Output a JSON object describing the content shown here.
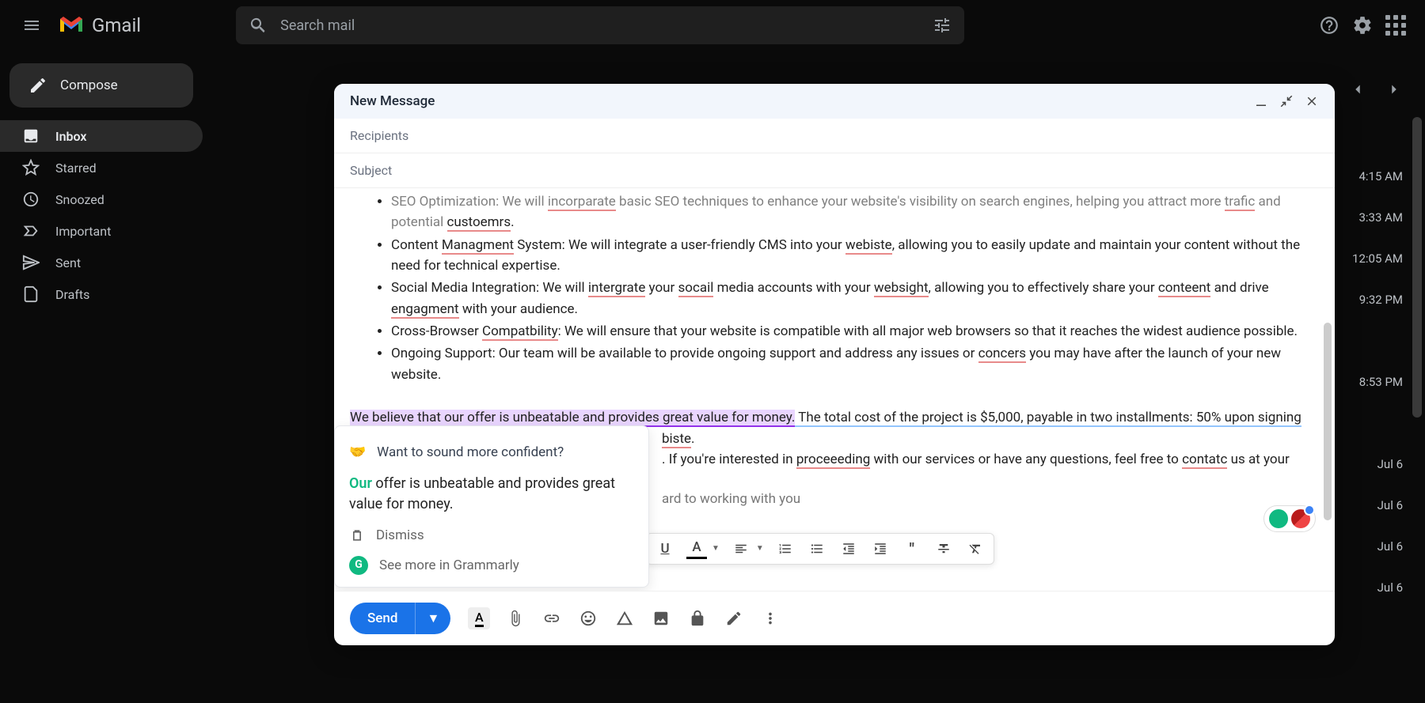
{
  "header": {
    "app_name": "Gmail",
    "search_placeholder": "Search mail"
  },
  "sidebar": {
    "compose": "Compose",
    "items": [
      {
        "label": "Inbox"
      },
      {
        "label": "Starred"
      },
      {
        "label": "Snoozed"
      },
      {
        "label": "Important"
      },
      {
        "label": "Sent"
      },
      {
        "label": "Drafts"
      }
    ]
  },
  "compose": {
    "title": "New Message",
    "recipients_label": "Recipients",
    "subject_label": "Subject",
    "send": "Send",
    "body": {
      "seo_pre": "SEO Optimization: We will ",
      "seo_m1": "incorparate",
      "seo_mid": " basic SEO techniques to enhance your website's visibility on search engines, helping you attract more ",
      "seo_m2": "trafic",
      "seo_post": " and potential ",
      "seo_m3": "custoemrs",
      "cms_pre": "Content ",
      "cms_m1": "Managment",
      "cms_mid": " System: We will integrate a user-friendly CMS into your ",
      "cms_m2": "webiste",
      "cms_post": ", allowing you to easily update and maintain your content without the need for technical expertise.",
      "social_pre": "Social Media Integration: We will ",
      "social_m1": "intergrate",
      "social_mid1": " your ",
      "social_m2": "socail",
      "social_mid2": " media accounts with your ",
      "social_m3": "websight",
      "social_mid3": ", allowing you to effectively share your ",
      "social_m4": "conteent",
      "social_mid4": " and drive ",
      "social_m5": "engagment",
      "social_post": " with your audience.",
      "cross_pre": "Cross-Browser ",
      "cross_m1": "Compatbility",
      "cross_post": ": We will ensure that your website is compatible with all major web browsers so that it reaches the widest audience possible.",
      "ongoing_pre": "Ongoing Support: Our team will be available to provide ongoing support and address any issues or ",
      "ongoing_m1": "concers",
      "ongoing_post": " you may have after the launch of your new website.",
      "believe": "We believe that our offer is unbeatable and provides great value for money.",
      "total": " The total cost of the project is $5,000, payable in two installments: 50% upon signing ",
      "biste": "biste",
      "interested_pre": ". If you're interested in ",
      "interested_m1": "proceeeding",
      "interested_mid": " with our services or have any questions, feel free to ",
      "interested_m2": "contatc",
      "interested_post": " us at your ",
      "working": "ard to working with you"
    }
  },
  "grammarly": {
    "prompt": "Want to sound more confident?",
    "our": "Our",
    "suggestion_rest": " offer is unbeatable and provides great value for money.",
    "dismiss": "Dismiss",
    "see_more": "See more in Grammarly"
  },
  "timestamps": [
    "4:15 AM",
    "3:33 AM",
    "12:05 AM",
    "9:32 PM",
    "",
    "8:53 PM",
    "",
    "Jul 6",
    "Jul 6",
    "Jul 6",
    "Jul 6"
  ]
}
